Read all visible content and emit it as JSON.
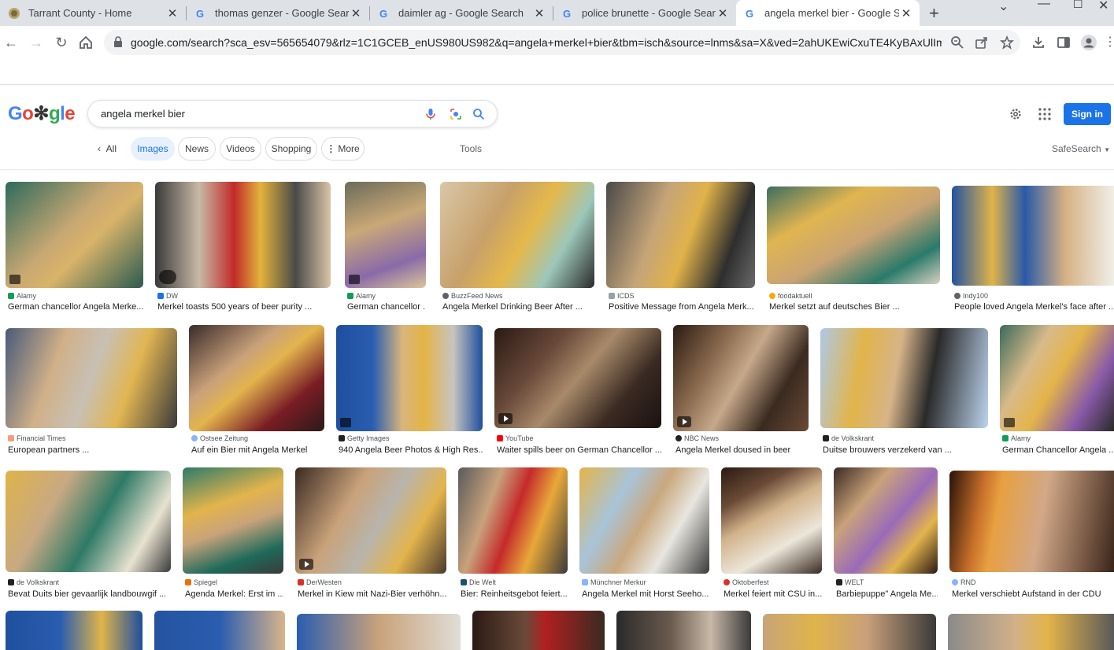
{
  "browser": {
    "tabs": [
      {
        "title": "Tarrant County - Home"
      },
      {
        "title": "thomas genzer - Google Search"
      },
      {
        "title": "daimler ag - Google Search"
      },
      {
        "title": "police brunette - Google Search"
      },
      {
        "title": "angela merkel bier - Google Search"
      }
    ],
    "url": "google.com/search?sca_esv=565654079&rlz=1C1GCEB_enUS980US982&q=angela+merkel+bier&tbm=isch&source=lnms&sa=X&ved=2ahUKEwiCxuTE4KyBAxUlIm..."
  },
  "header": {
    "logo": "Google",
    "query": "angela merkel bier",
    "sign_in": "Sign in"
  },
  "filters": {
    "all": "All",
    "chips": [
      "Images",
      "News",
      "Videos",
      "Shopping",
      "More"
    ],
    "tools": "Tools",
    "safesearch": "SafeSearch"
  },
  "results": [
    [
      {
        "source": "Alamy",
        "caption": "German chancellor Angela Merke...",
        "src_color": "#0f9d58"
      },
      {
        "source": "DW",
        "caption": "Merkel toasts 500 years of beer purity ...",
        "src_color": "#1a73e8"
      },
      {
        "source": "Alamy",
        "caption": "German chancellor ...",
        "src_color": "#0f9d58"
      },
      {
        "source": "BuzzFeed News",
        "caption": "Angela Merkel Drinking Beer After ...",
        "src_color": "#5f6368"
      },
      {
        "source": "ICDS",
        "caption": "Positive Message from Angela Merk...",
        "src_color": "#9aa0a6"
      },
      {
        "source": "foodaktuell",
        "caption": "Merkel setzt auf deutsches Bier ...",
        "src_color": "#f9ab00"
      },
      {
        "source": "Indy100",
        "caption": "People loved Angela Merkel's face after ...",
        "src_color": "#5f6368"
      }
    ],
    [
      {
        "source": "Financial Times",
        "caption": "European partners ...",
        "src_color": "#f29d7a"
      },
      {
        "source": "Ostsee Zeitung",
        "caption": "Auf ein Bier mit Angela Merkel",
        "src_color": "#8ab4f8"
      },
      {
        "source": "Getty Images",
        "caption": "940 Angela Beer Photos & High Res...",
        "src_color": "#202124"
      },
      {
        "source": "YouTube",
        "caption": "Waiter spills beer on German Chancellor ...",
        "src_color": "#ff0000"
      },
      {
        "source": "NBC News",
        "caption": "Angela Merkel doused in beer",
        "src_color": "#202124"
      },
      {
        "source": "de Volkskrant",
        "caption": "Duitse brouwers verzekerd van ...",
        "src_color": "#202124"
      },
      {
        "source": "Alamy",
        "caption": "German Chancellor Angela ...",
        "src_color": "#0f9d58"
      }
    ],
    [
      {
        "source": "de Volkskrant",
        "caption": "Bevat Duits bier gevaarlijk landbouwgif ...",
        "src_color": "#202124"
      },
      {
        "source": "Spiegel",
        "caption": "Agenda Merkel: Erst im ...",
        "src_color": "#e8710a"
      },
      {
        "source": "DerWesten",
        "caption": "Merkel in Kiew mit Nazi-Bier verhöhn...",
        "src_color": "#d93025"
      },
      {
        "source": "Die Welt",
        "caption": "Bier: Reinheitsgebot feiert...",
        "src_color": "#1a5276"
      },
      {
        "source": "Münchner Merkur",
        "caption": "Angela Merkel mit Horst Seeho...",
        "src_color": "#8ab4f8"
      },
      {
        "source": "Oktoberfest",
        "caption": "Merkel feiert mit CSU in...",
        "src_color": "#d93025"
      },
      {
        "source": "WELT",
        "caption": "Barbiepuppe\" Angela Me...",
        "src_color": "#202124"
      },
      {
        "source": "RND",
        "caption": "Merkel verschiebt Aufstand in der CDU",
        "src_color": "#8ab4f8"
      }
    ]
  ],
  "colors": {
    "accent": "#1a73e8",
    "chip_selected_bg": "#e8f0fe"
  }
}
